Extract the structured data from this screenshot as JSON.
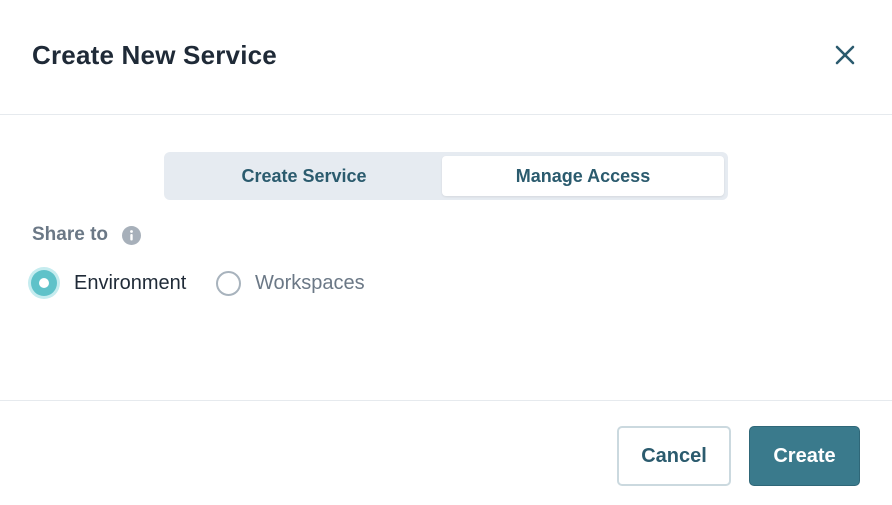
{
  "dialog": {
    "title": "Create New Service",
    "close_icon": "close-icon"
  },
  "tabs": [
    {
      "label": "Create Service",
      "active": false
    },
    {
      "label": "Manage Access",
      "active": true
    }
  ],
  "share": {
    "label": "Share to",
    "info_icon": "info-icon",
    "options": [
      {
        "label": "Environment",
        "checked": true
      },
      {
        "label": "Workspaces",
        "checked": false
      }
    ]
  },
  "footer": {
    "cancel_label": "Cancel",
    "create_label": "Create"
  },
  "colors": {
    "primary": "#3a7a8c",
    "radio_active": "#5fc2c9",
    "title_text": "#1f2a37",
    "muted_text": "#6b7886"
  }
}
